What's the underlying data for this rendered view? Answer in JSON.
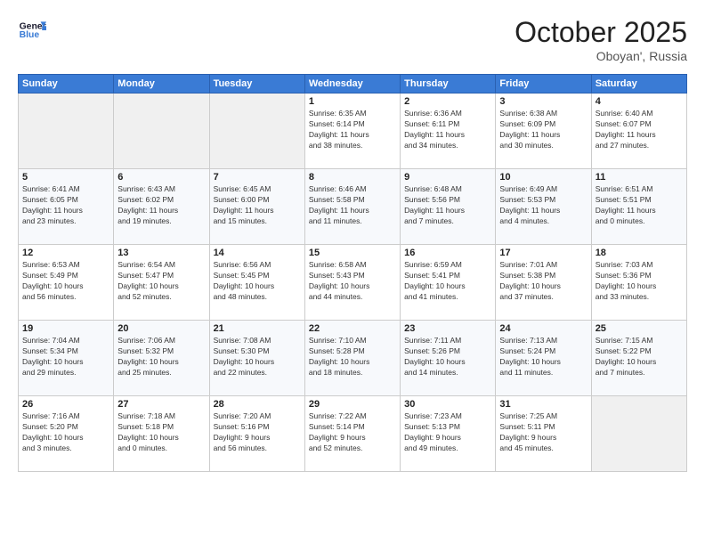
{
  "header": {
    "title": "October 2025",
    "location": "Oboyan', Russia"
  },
  "calendar": {
    "headers": [
      "Sunday",
      "Monday",
      "Tuesday",
      "Wednesday",
      "Thursday",
      "Friday",
      "Saturday"
    ],
    "weeks": [
      [
        {
          "day": "",
          "info": ""
        },
        {
          "day": "",
          "info": ""
        },
        {
          "day": "",
          "info": ""
        },
        {
          "day": "1",
          "info": "Sunrise: 6:35 AM\nSunset: 6:14 PM\nDaylight: 11 hours\nand 38 minutes."
        },
        {
          "day": "2",
          "info": "Sunrise: 6:36 AM\nSunset: 6:11 PM\nDaylight: 11 hours\nand 34 minutes."
        },
        {
          "day": "3",
          "info": "Sunrise: 6:38 AM\nSunset: 6:09 PM\nDaylight: 11 hours\nand 30 minutes."
        },
        {
          "day": "4",
          "info": "Sunrise: 6:40 AM\nSunset: 6:07 PM\nDaylight: 11 hours\nand 27 minutes."
        }
      ],
      [
        {
          "day": "5",
          "info": "Sunrise: 6:41 AM\nSunset: 6:05 PM\nDaylight: 11 hours\nand 23 minutes."
        },
        {
          "day": "6",
          "info": "Sunrise: 6:43 AM\nSunset: 6:02 PM\nDaylight: 11 hours\nand 19 minutes."
        },
        {
          "day": "7",
          "info": "Sunrise: 6:45 AM\nSunset: 6:00 PM\nDaylight: 11 hours\nand 15 minutes."
        },
        {
          "day": "8",
          "info": "Sunrise: 6:46 AM\nSunset: 5:58 PM\nDaylight: 11 hours\nand 11 minutes."
        },
        {
          "day": "9",
          "info": "Sunrise: 6:48 AM\nSunset: 5:56 PM\nDaylight: 11 hours\nand 7 minutes."
        },
        {
          "day": "10",
          "info": "Sunrise: 6:49 AM\nSunset: 5:53 PM\nDaylight: 11 hours\nand 4 minutes."
        },
        {
          "day": "11",
          "info": "Sunrise: 6:51 AM\nSunset: 5:51 PM\nDaylight: 11 hours\nand 0 minutes."
        }
      ],
      [
        {
          "day": "12",
          "info": "Sunrise: 6:53 AM\nSunset: 5:49 PM\nDaylight: 10 hours\nand 56 minutes."
        },
        {
          "day": "13",
          "info": "Sunrise: 6:54 AM\nSunset: 5:47 PM\nDaylight: 10 hours\nand 52 minutes."
        },
        {
          "day": "14",
          "info": "Sunrise: 6:56 AM\nSunset: 5:45 PM\nDaylight: 10 hours\nand 48 minutes."
        },
        {
          "day": "15",
          "info": "Sunrise: 6:58 AM\nSunset: 5:43 PM\nDaylight: 10 hours\nand 44 minutes."
        },
        {
          "day": "16",
          "info": "Sunrise: 6:59 AM\nSunset: 5:41 PM\nDaylight: 10 hours\nand 41 minutes."
        },
        {
          "day": "17",
          "info": "Sunrise: 7:01 AM\nSunset: 5:38 PM\nDaylight: 10 hours\nand 37 minutes."
        },
        {
          "day": "18",
          "info": "Sunrise: 7:03 AM\nSunset: 5:36 PM\nDaylight: 10 hours\nand 33 minutes."
        }
      ],
      [
        {
          "day": "19",
          "info": "Sunrise: 7:04 AM\nSunset: 5:34 PM\nDaylight: 10 hours\nand 29 minutes."
        },
        {
          "day": "20",
          "info": "Sunrise: 7:06 AM\nSunset: 5:32 PM\nDaylight: 10 hours\nand 25 minutes."
        },
        {
          "day": "21",
          "info": "Sunrise: 7:08 AM\nSunset: 5:30 PM\nDaylight: 10 hours\nand 22 minutes."
        },
        {
          "day": "22",
          "info": "Sunrise: 7:10 AM\nSunset: 5:28 PM\nDaylight: 10 hours\nand 18 minutes."
        },
        {
          "day": "23",
          "info": "Sunrise: 7:11 AM\nSunset: 5:26 PM\nDaylight: 10 hours\nand 14 minutes."
        },
        {
          "day": "24",
          "info": "Sunrise: 7:13 AM\nSunset: 5:24 PM\nDaylight: 10 hours\nand 11 minutes."
        },
        {
          "day": "25",
          "info": "Sunrise: 7:15 AM\nSunset: 5:22 PM\nDaylight: 10 hours\nand 7 minutes."
        }
      ],
      [
        {
          "day": "26",
          "info": "Sunrise: 7:16 AM\nSunset: 5:20 PM\nDaylight: 10 hours\nand 3 minutes."
        },
        {
          "day": "27",
          "info": "Sunrise: 7:18 AM\nSunset: 5:18 PM\nDaylight: 10 hours\nand 0 minutes."
        },
        {
          "day": "28",
          "info": "Sunrise: 7:20 AM\nSunset: 5:16 PM\nDaylight: 9 hours\nand 56 minutes."
        },
        {
          "day": "29",
          "info": "Sunrise: 7:22 AM\nSunset: 5:14 PM\nDaylight: 9 hours\nand 52 minutes."
        },
        {
          "day": "30",
          "info": "Sunrise: 7:23 AM\nSunset: 5:13 PM\nDaylight: 9 hours\nand 49 minutes."
        },
        {
          "day": "31",
          "info": "Sunrise: 7:25 AM\nSunset: 5:11 PM\nDaylight: 9 hours\nand 45 minutes."
        },
        {
          "day": "",
          "info": ""
        }
      ]
    ]
  }
}
